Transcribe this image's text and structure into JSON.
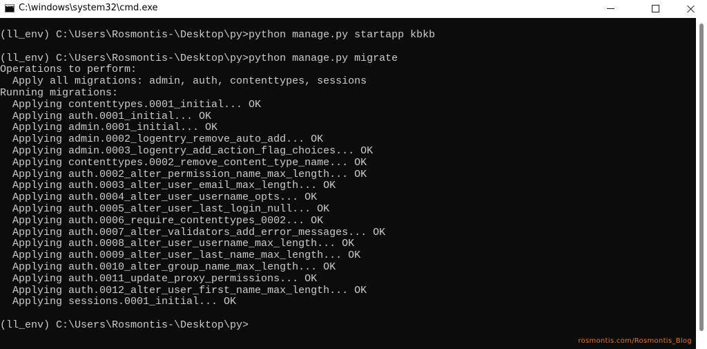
{
  "window": {
    "title": "C:\\windows\\system32\\cmd.exe",
    "icon": "cmd-icon",
    "controls": {
      "minimize": "minimize-icon",
      "maximize": "maximize-icon",
      "close": "close-icon"
    }
  },
  "console": {
    "background": "#0c0c0c",
    "foreground": "#cccccc",
    "lines": [
      "(ll_env) C:\\Users\\Rosmontis-\\Desktop\\py>python manage.py startapp kbkb",
      "",
      "(ll_env) C:\\Users\\Rosmontis-\\Desktop\\py>python manage.py migrate",
      "Operations to perform:",
      "  Apply all migrations: admin, auth, contenttypes, sessions",
      "Running migrations:",
      "  Applying contenttypes.0001_initial... OK",
      "  Applying auth.0001_initial... OK",
      "  Applying admin.0001_initial... OK",
      "  Applying admin.0002_logentry_remove_auto_add... OK",
      "  Applying admin.0003_logentry_add_action_flag_choices... OK",
      "  Applying contenttypes.0002_remove_content_type_name... OK",
      "  Applying auth.0002_alter_permission_name_max_length... OK",
      "  Applying auth.0003_alter_user_email_max_length... OK",
      "  Applying auth.0004_alter_user_username_opts... OK",
      "  Applying auth.0005_alter_user_last_login_null... OK",
      "  Applying auth.0006_require_contenttypes_0002... OK",
      "  Applying auth.0007_alter_validators_add_error_messages... OK",
      "  Applying auth.0008_alter_user_username_max_length... OK",
      "  Applying auth.0009_alter_user_last_name_max_length... OK",
      "  Applying auth.0010_alter_group_name_max_length... OK",
      "  Applying auth.0011_update_proxy_permissions... OK",
      "  Applying auth.0012_alter_user_first_name_max_length... OK",
      "  Applying sessions.0001_initial... OK",
      "",
      "(ll_env) C:\\Users\\Rosmontis-\\Desktop\\py>"
    ]
  },
  "watermark": "rosmontis.com/Rosmontis_Blog",
  "watermark_color": "#e07a3a"
}
